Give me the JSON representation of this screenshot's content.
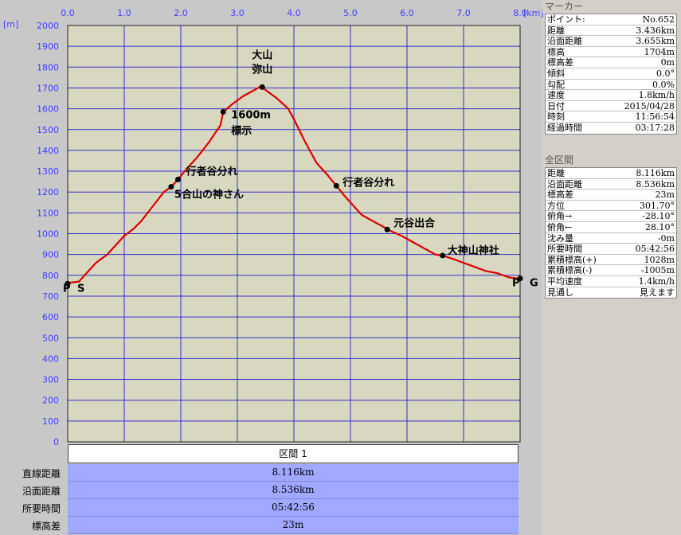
{
  "marker_panel": {
    "title": "マーカー",
    "rows": [
      {
        "label": "ポイント:",
        "value": "No.652"
      },
      {
        "label": "距離",
        "value": "3.436km"
      },
      {
        "label": "沿面距離",
        "value": "3.655km"
      },
      {
        "label": "標高",
        "value": "1704m"
      },
      {
        "label": "標高差",
        "value": "0m"
      },
      {
        "label": "傾斜",
        "value": "0.0°"
      },
      {
        "label": "勾配",
        "value": "0.0%"
      },
      {
        "label": "速度",
        "value": "1.8km/h"
      },
      {
        "label": "日付",
        "value": "2015/04/28"
      },
      {
        "label": "時刻",
        "value": "11:56:54"
      },
      {
        "label": "経過時間",
        "value": "03:17:28"
      }
    ]
  },
  "total_panel": {
    "title": "全区間",
    "rows": [
      {
        "label": "距離",
        "value": "8.116km"
      },
      {
        "label": "沿面距離",
        "value": "8.536km"
      },
      {
        "label": "標高差",
        "value": "23m"
      },
      {
        "label": "方位",
        "value": "301.70°"
      },
      {
        "label": "俯角→",
        "value": "-28.10°"
      },
      {
        "label": "俯角←",
        "value": "28.10°"
      },
      {
        "label": "沈み量",
        "value": "-0m"
      },
      {
        "label": "所要時間",
        "value": "05:42:56"
      },
      {
        "label": "累積標高(+)",
        "value": "1028m"
      },
      {
        "label": "累積標高(-)",
        "value": "-1005m"
      },
      {
        "label": "平均速度",
        "value": "1.4km/h"
      },
      {
        "label": "見通し",
        "value": "見えます"
      }
    ]
  },
  "section": {
    "label": "区間 1",
    "stats": [
      {
        "label": "直線距離",
        "value": "8.116km"
      },
      {
        "label": "沿面距離",
        "value": "8.536km"
      },
      {
        "label": "所要時間",
        "value": "05:42:56"
      },
      {
        "label": "標高差",
        "value": "23m"
      }
    ]
  },
  "colors": {
    "plot_bg": "#d8d8c0",
    "grid": "#3030d0",
    "axis_text": "#4040ff",
    "profile": "#dd0000",
    "stat_band": "#a0a8ff",
    "panel_bg": "#d4d0c8"
  },
  "chart_data": {
    "type": "line",
    "xlabel": "[km]",
    "ylabel": "[m]",
    "xlim": [
      0.0,
      8.0
    ],
    "ylim": [
      0,
      2000
    ],
    "x_ticks": [
      "0.0",
      "1.0",
      "2.0",
      "3.0",
      "4.0",
      "5.0",
      "6.0",
      "7.0",
      "8.0"
    ],
    "y_ticks": [
      "0",
      "100",
      "200",
      "300",
      "400",
      "500",
      "600",
      "700",
      "800",
      "900",
      "1000",
      "1100",
      "1200",
      "1300",
      "1400",
      "1500",
      "1600",
      "1700",
      "1800",
      "1900",
      "2000"
    ],
    "grid": true,
    "series": [
      {
        "x": [
          0.0,
          0.05,
          0.2,
          0.3,
          0.5,
          0.7,
          0.9,
          1.0,
          1.15,
          1.3,
          1.5,
          1.7,
          1.83,
          1.95,
          2.1,
          2.3,
          2.5,
          2.7,
          2.75,
          2.9,
          3.1,
          3.3,
          3.4,
          3.44,
          3.5,
          3.7,
          3.9,
          4.0,
          4.2,
          4.4,
          4.6,
          4.75,
          4.9,
          5.0,
          5.2,
          5.4,
          5.6,
          5.65,
          5.9,
          6.1,
          6.3,
          6.5,
          6.63,
          6.8,
          7.0,
          7.2,
          7.4,
          7.6,
          7.8,
          7.95,
          8.0
        ],
        "y": [
          760,
          765,
          770,
          800,
          860,
          900,
          960,
          990,
          1020,
          1060,
          1130,
          1200,
          1225,
          1260,
          1310,
          1370,
          1440,
          1520,
          1585,
          1620,
          1660,
          1690,
          1705,
          1704,
          1690,
          1650,
          1600,
          1550,
          1440,
          1340,
          1280,
          1230,
          1180,
          1150,
          1090,
          1060,
          1030,
          1020,
          990,
          960,
          930,
          900,
          895,
          880,
          860,
          840,
          820,
          810,
          790,
          785,
          785
        ]
      }
    ],
    "markers": [
      {
        "x": 0.0,
        "y": 760
      },
      {
        "x": 1.83,
        "y": 1225
      },
      {
        "x": 1.95,
        "y": 1260
      },
      {
        "x": 2.75,
        "y": 1585
      },
      {
        "x": 3.44,
        "y": 1704
      },
      {
        "x": 4.75,
        "y": 1230
      },
      {
        "x": 5.65,
        "y": 1020
      },
      {
        "x": 6.63,
        "y": 895
      },
      {
        "x": 8.0,
        "y": 785
      }
    ],
    "annotations": [
      {
        "text": "大山",
        "x": 3.44,
        "y": 1704
      },
      {
        "text": "弥山",
        "x": 3.44,
        "y": 1704
      },
      {
        "text": "1600m",
        "x": 2.75,
        "y": 1585
      },
      {
        "text": "標示",
        "x": 2.75,
        "y": 1585
      },
      {
        "text": "行者谷分れ",
        "x": 1.95,
        "y": 1260
      },
      {
        "text": "5合山の神さん",
        "x": 1.83,
        "y": 1225
      },
      {
        "text": "行者谷分れ",
        "x": 4.75,
        "y": 1230
      },
      {
        "text": "元谷出合",
        "x": 5.65,
        "y": 1020
      },
      {
        "text": "大神山神社",
        "x": 6.63,
        "y": 895
      },
      {
        "text": "P",
        "x": 0.0,
        "y": 760
      },
      {
        "text": "S",
        "x": 0.0,
        "y": 760
      },
      {
        "text": "P",
        "x": 8.0,
        "y": 785
      },
      {
        "text": "G",
        "x": 8.0,
        "y": 785
      }
    ]
  }
}
